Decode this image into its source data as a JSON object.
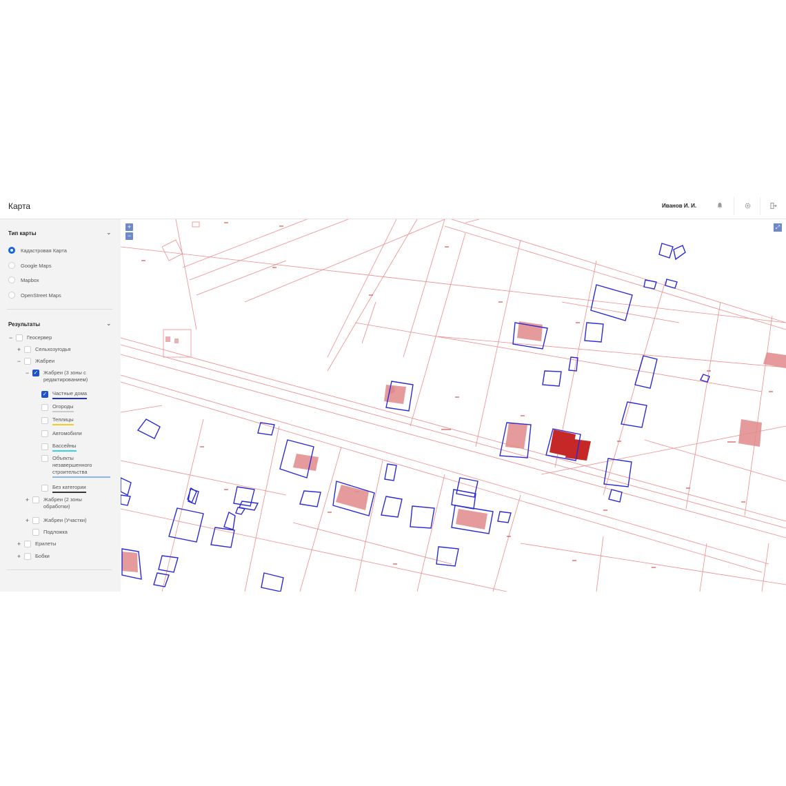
{
  "header": {
    "title": "Карта",
    "user": "Иванов И. И.",
    "icons": [
      "bell-icon",
      "gear-icon",
      "logout-icon"
    ]
  },
  "sidebar": {
    "map_type": {
      "title": "Тип карты",
      "options": [
        "Кадастровая Карта",
        "Google Maps",
        "Mapbox",
        "OpenStreet Maps"
      ],
      "selected": "Кадастровая Карта"
    },
    "results": {
      "title": "Результаты",
      "tree": [
        {
          "label": "Геосервер",
          "toggle": "−",
          "checked": false
        },
        {
          "label": "Сельхозугодья",
          "toggle": "+",
          "checked": false
        },
        {
          "label": "Жабреи",
          "toggle": "−",
          "checked": false
        },
        {
          "label": "Жабреи (3 зоны с редактированием)",
          "toggle": "−",
          "checked": true
        },
        {
          "label": "Частные дома",
          "checked": true,
          "underline": "#1d2fd0"
        },
        {
          "label": "Огороды",
          "checked": false,
          "underline": "#c9c9c9"
        },
        {
          "label": "Теплицы",
          "checked": false,
          "underline": "#f2cc1f"
        },
        {
          "label": "Автомобили",
          "checked": false
        },
        {
          "label": "Бассейны",
          "checked": false,
          "underline": "#36d1e8"
        },
        {
          "label": "Объекты незавершенного строительства",
          "checked": false,
          "underline": "#8bb4f0"
        },
        {
          "label": "Без категории",
          "checked": false,
          "underline": "#333333"
        },
        {
          "label": "Жабреи (2 зоны обработки)",
          "toggle": "+",
          "checked": false
        },
        {
          "label": "Жабреи (Участки)",
          "toggle": "+",
          "checked": false
        },
        {
          "label": "Подложка",
          "checked": false
        },
        {
          "label": "Ерилеты",
          "toggle": "+",
          "checked": false
        },
        {
          "label": "Бобки",
          "toggle": "+",
          "checked": false
        }
      ]
    }
  },
  "map": {
    "zoom_in": "+",
    "zoom_out": "−",
    "colors": {
      "parcel": "#f08a8a",
      "building_outline": "#2a2ad8",
      "building_fill": "#e08a8a",
      "building_dark": "#c62828"
    }
  }
}
